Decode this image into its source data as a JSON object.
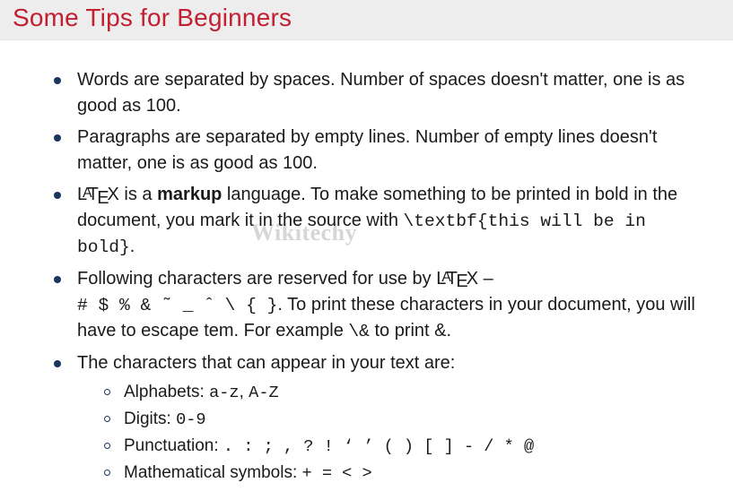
{
  "title": "Some Tips for Beginners",
  "watermark": "Wikitechy",
  "items": {
    "i0": "Words are separated by spaces. Number of spaces doesn't matter, one is as good as 100.",
    "i1": "Paragraphs are separated by empty lines. Number of empty lines doesn't matter, one is as good as 100.",
    "i2": {
      "pre": "",
      "markupWord": "markup",
      "mid1": " is a ",
      "mid2": " language. To make something to be printed in bold in the document, you mark it in the source with ",
      "code": "\\textbf{this will be in bold}",
      "tail": "."
    },
    "i3": {
      "pre": "Following characters are reserved for use by ",
      "dash": " –",
      "chars": "# $ % & ˜ _ ˆ \\ { }",
      "mid": ". To print these characters in your document, you will have to escape tem. For example ",
      "esc": "\\&",
      "tail": " to print &."
    },
    "i4": {
      "text": "The characters that can appear in your text are:",
      "sub": {
        "s0": {
          "label": "Alphabets: ",
          "code": "a-z",
          "sep": ", ",
          "code2": "A-Z"
        },
        "s1": {
          "label": "Digits: ",
          "code": "0-9"
        },
        "s2": {
          "label": "Punctuation: ",
          "code": ". : ; , ? ! ‘ ’ ( ) [ ] - / * @"
        },
        "s3": {
          "label": "Mathematical symbols: ",
          "code": "+ = < >"
        }
      }
    }
  }
}
